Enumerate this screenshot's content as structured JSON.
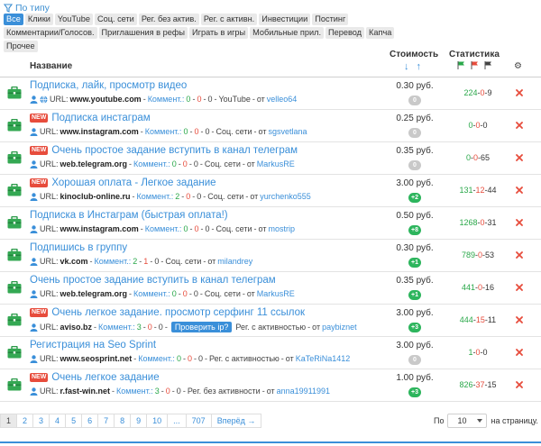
{
  "filter": {
    "label": "По типу"
  },
  "categories": [
    "Все",
    "Клики",
    "YouTube",
    "Соц. сети",
    "Рег. без актив.",
    "Рег. с активн.",
    "Инвестиции",
    "Постинг",
    "Комментарии/Голосов.",
    "Приглашения в рефы",
    "Играть в игры",
    "Мобильные прил.",
    "Перевод",
    "Капча",
    "Прочее"
  ],
  "header": {
    "name": "Название",
    "cost": "Стоимость",
    "stats": "Статистика",
    "sort_down": "↓",
    "sort_up": "↑",
    "gears": "⚙"
  },
  "meta": {
    "url_label": "URL:",
    "comments_label": "Коммент.:",
    "by_label": "от",
    "dash": "-",
    "check_ip": "Проверить ip?"
  },
  "tasks": [
    {
      "new": "",
      "title": "Подписка, лайк, просмотр видео",
      "globe": true,
      "url": "www.youtube.com",
      "c1": "0",
      "c2": "0",
      "c3": "0",
      "category": "YouTube",
      "author": "velleo64",
      "check_ip": false,
      "price": "0.30 руб.",
      "badge": "0",
      "badge_color": "grey",
      "s1": "224",
      "s2": "0",
      "s3": "9"
    },
    {
      "new": "NEW",
      "title": "Подписка инстаграм",
      "globe": false,
      "url": "www.instagram.com",
      "c1": "0",
      "c2": "0",
      "c3": "0",
      "category": "Соц. сети",
      "author": "sgsvetlana",
      "check_ip": false,
      "price": "0.25 руб.",
      "badge": "0",
      "badge_color": "grey",
      "s1": "0",
      "s2": "0",
      "s3": "0"
    },
    {
      "new": "NEW",
      "title": "Очень простое задание вступить в канал телеграм",
      "globe": false,
      "url": "web.telegram.org",
      "c1": "0",
      "c2": "0",
      "c3": "0",
      "category": "Соц. сети",
      "author": "MarkusRE",
      "check_ip": false,
      "price": "0.35 руб.",
      "badge": "0",
      "badge_color": "grey",
      "s1": "0",
      "s2": "0",
      "s3": "65"
    },
    {
      "new": "NEW",
      "title": "Хорошая оплата - Легкое задание",
      "globe": false,
      "url": "kinoclub-online.ru",
      "c1": "2",
      "c2": "0",
      "c3": "0",
      "category": "Соц. сети",
      "author": "yurchenko555",
      "check_ip": false,
      "price": "3.00 руб.",
      "badge": "+2",
      "badge_color": "green",
      "s1": "131",
      "s2": "12",
      "s3": "44"
    },
    {
      "new": "",
      "title": "Подписка в Инстаграм (быстрая оплата!)",
      "globe": false,
      "url": "www.instagram.com",
      "c1": "0",
      "c2": "0",
      "c3": "0",
      "category": "Соц. сети",
      "author": "mostrip",
      "check_ip": false,
      "price": "0.50 руб.",
      "badge": "+8",
      "badge_color": "green",
      "s1": "1268",
      "s2": "0",
      "s3": "31"
    },
    {
      "new": "",
      "title": "Подпишись в группу",
      "globe": false,
      "url": "vk.com",
      "c1": "2",
      "c2": "1",
      "c3": "0",
      "category": "Соц. сети",
      "author": "milandrey",
      "check_ip": false,
      "price": "0.30 руб.",
      "badge": "+1",
      "badge_color": "green",
      "s1": "789",
      "s2": "0",
      "s3": "53"
    },
    {
      "new": "",
      "title": "Очень простое задание вступить в канал телеграм",
      "globe": false,
      "url": "web.telegram.org",
      "c1": "0",
      "c2": "0",
      "c3": "0",
      "category": "Соц. сети",
      "author": "MarkusRE",
      "check_ip": false,
      "price": "0.35 руб.",
      "badge": "+1",
      "badge_color": "green",
      "s1": "441",
      "s2": "0",
      "s3": "16"
    },
    {
      "new": "NEW",
      "title": "Очень легкое задание. просмотр серфинг 11 ссылок",
      "globe": false,
      "url": "aviso.bz",
      "c1": "3",
      "c2": "0",
      "c3": "0",
      "category": "Рег. с активностью",
      "author": "paybiznet",
      "check_ip": true,
      "price": "3.00 руб.",
      "badge": "+3",
      "badge_color": "green",
      "s1": "444",
      "s2": "15",
      "s3": "11"
    },
    {
      "new": "",
      "title": "Регистрация на Seo Sprint",
      "globe": false,
      "url": "www.seosprint.net",
      "c1": "0",
      "c2": "0",
      "c3": "0",
      "category": "Рег. с активностью",
      "author": "KaTeRiNa1412",
      "check_ip": false,
      "price": "3.00 руб.",
      "badge": "0",
      "badge_color": "grey",
      "s1": "1",
      "s2": "0",
      "s3": "0"
    },
    {
      "new": "NEW",
      "title": "Очень легкое задание",
      "globe": false,
      "url": "r.fast-win.net",
      "c1": "3",
      "c2": "0",
      "c3": "0",
      "category": "Рег. без активности",
      "author": "anna19911991",
      "check_ip": false,
      "price": "1.00 руб.",
      "badge": "+3",
      "badge_color": "green",
      "s1": "826",
      "s2": "37",
      "s3": "15"
    }
  ],
  "pagination": [
    "1",
    "2",
    "3",
    "4",
    "5",
    "6",
    "7",
    "8",
    "9",
    "10",
    "...",
    "707",
    "Вперёд →"
  ],
  "per_page": {
    "prefix": "По",
    "value": "10",
    "suffix": "на страницу."
  },
  "colors": {
    "accent": "#3a8fd9",
    "green": "#2db55d",
    "red": "#e74c3c"
  }
}
